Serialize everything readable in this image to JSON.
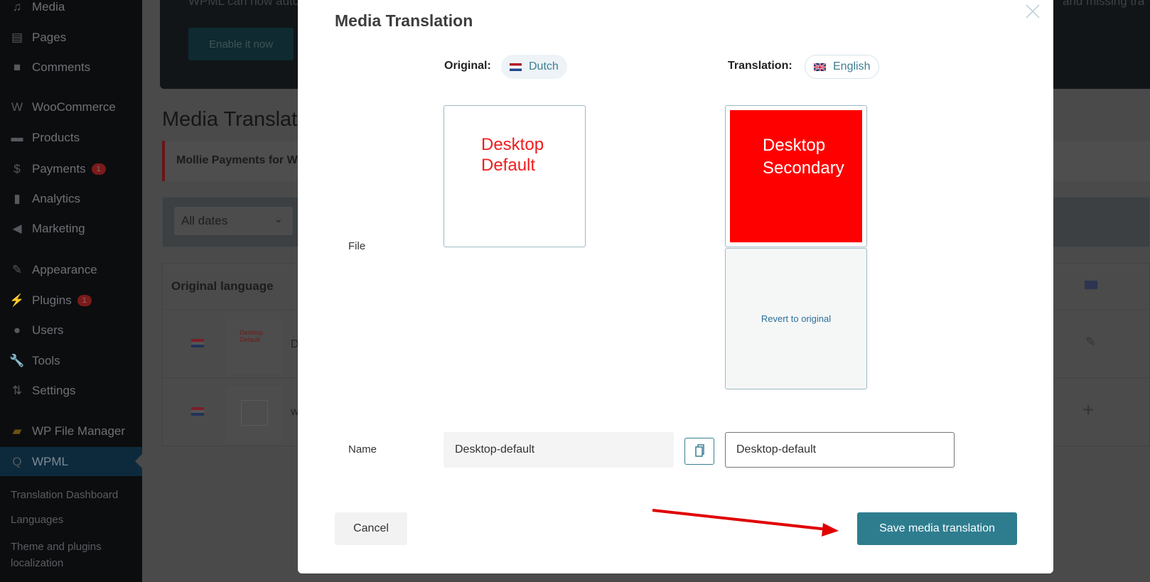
{
  "sidebar": {
    "items": [
      {
        "label": "Media",
        "icon": "media-icon"
      },
      {
        "label": "Pages",
        "icon": "pages-icon"
      },
      {
        "label": "Comments",
        "icon": "comments-icon"
      },
      {
        "label": "WooCommerce",
        "icon": "woocommerce-icon"
      },
      {
        "label": "Products",
        "icon": "products-icon"
      },
      {
        "label": "Payments",
        "icon": "payments-icon",
        "badge": "1"
      },
      {
        "label": "Analytics",
        "icon": "analytics-icon"
      },
      {
        "label": "Marketing",
        "icon": "marketing-icon"
      },
      {
        "label": "Appearance",
        "icon": "appearance-icon"
      },
      {
        "label": "Plugins",
        "icon": "plugins-icon",
        "badge": "1"
      },
      {
        "label": "Users",
        "icon": "users-icon"
      },
      {
        "label": "Tools",
        "icon": "tools-icon"
      },
      {
        "label": "Settings",
        "icon": "settings-icon"
      },
      {
        "label": "WP File Manager",
        "icon": "file-manager-icon"
      },
      {
        "label": "WPML",
        "icon": "wpml-icon"
      }
    ],
    "submenu": [
      "Translation Dashboard",
      "Languages",
      "Theme and plugins localization"
    ]
  },
  "background": {
    "banner_text_left": "WPML can now auto",
    "banner_text_right": "and missing tra",
    "enable_button": "Enable it now",
    "page_title": "Media Translati",
    "notice": "Mollie Payments for W",
    "date_filter": "All dates",
    "table_header": "Original language",
    "row1_thumb": "Desktop Default",
    "row1_name": "D",
    "row2_name": "w"
  },
  "modal": {
    "title": "Media Translation",
    "original_label": "Original:",
    "original_lang": "Dutch",
    "translation_label": "Translation:",
    "translation_lang": "English",
    "file_label": "File",
    "original_image_text": "Desktop Default",
    "translated_image_text": "Desktop Secondary",
    "revert": "Revert to original",
    "name_label": "Name",
    "original_name": "Desktop-default",
    "translated_name": "Desktop-default",
    "cancel": "Cancel",
    "save": "Save media translation"
  },
  "colors": {
    "accent": "#2e7d8f",
    "image_red": "#ff0000",
    "arrow": "#e00000"
  }
}
